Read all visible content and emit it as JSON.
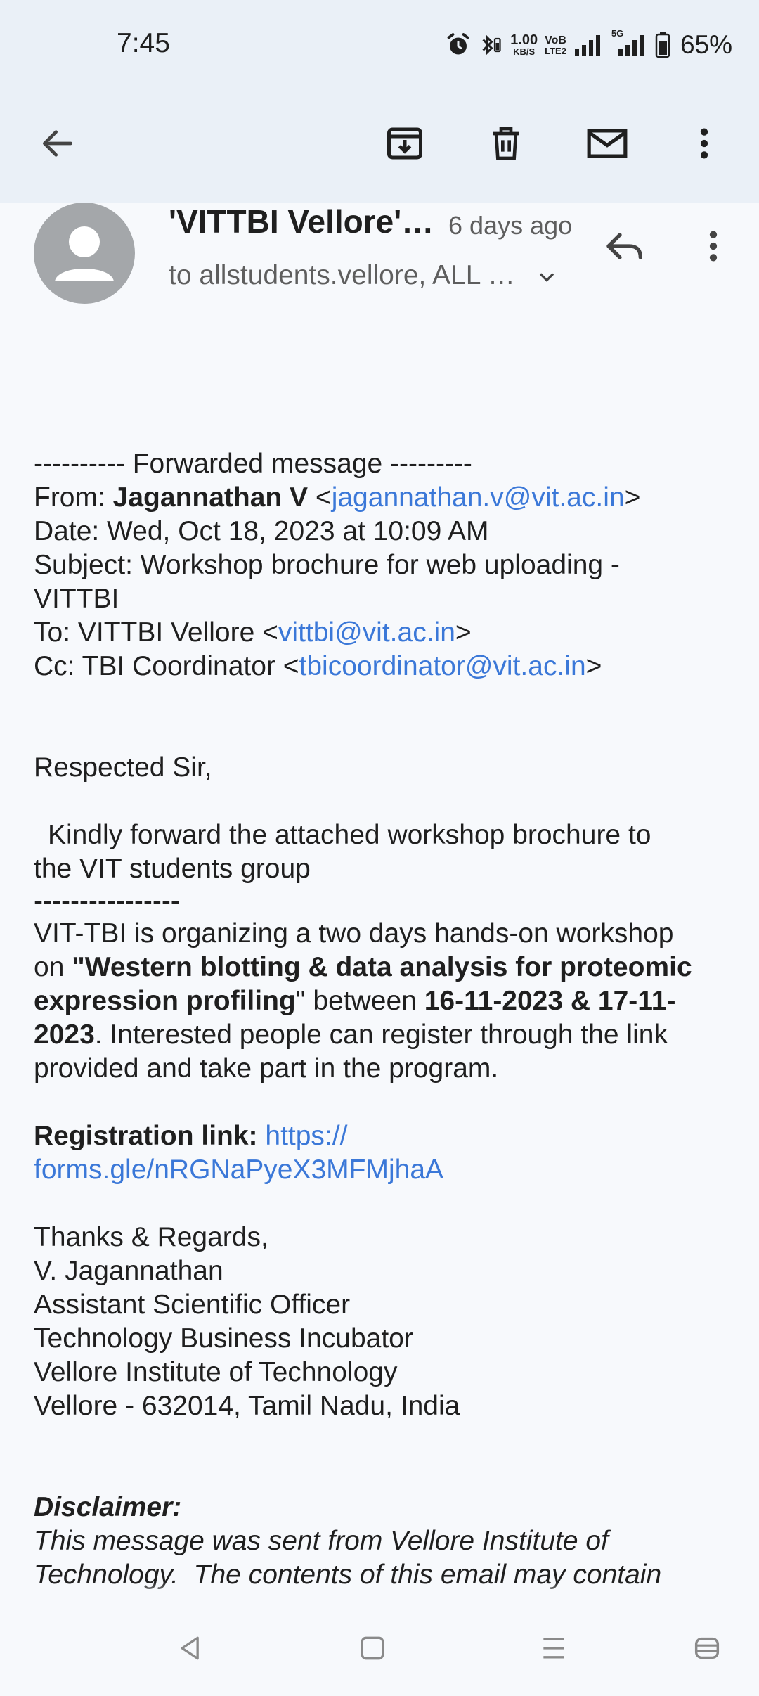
{
  "status_bar": {
    "time": "7:45",
    "speed_value": "1.00",
    "speed_unit": "KB/S",
    "volte_top": "VoB",
    "volte_bottom": "LTE2",
    "network_5g": "5G",
    "battery": "65%"
  },
  "app_bar": {
    "back_icon": "arrow-left-icon",
    "archive_icon": "archive-icon",
    "delete_icon": "trash-icon",
    "mark_unread_icon": "mail-icon",
    "more_icon": "more-vertical-icon"
  },
  "header": {
    "sender": "'VITTBI Vellore' via allstudents.vellore",
    "time_ago": "6 days ago",
    "recipients": "to allstudents.vellore, ALL STUDENTS"
  },
  "body": {
    "forwarded_line": "---------- Forwarded message ---------",
    "from_label": "From: ",
    "from_name": "Jagannathan V",
    "from_email": "jagannathan.v@vit.ac.in",
    "date_line": "Date: Wed, Oct 18, 2023 at 10:09 AM",
    "subject_line_1": "Subject: Workshop brochure for web uploading -",
    "subject_line_2": "VITTBI",
    "to_label": "To: VITTBI Vellore <",
    "to_email": "vittbi@vit.ac.in",
    "cc_label": "Cc: TBI Coordinator <",
    "cc_email": "tbicoordinator@vit.ac.in",
    "greeting": "Respected Sir,",
    "request_1": "Kindly forward the attached workshop brochure to",
    "request_2": "the VIT students group",
    "separator": "----------------",
    "intro_1": "VIT-TBI is organizing a two days hands-on workshop",
    "intro_on": "on ",
    "workshop_title_1": "\"Western blotting & data analysis for proteomic",
    "workshop_title_2": "expression profiling",
    "quote_close": "\"",
    "between": " between ",
    "dates_1": "16-11-2023 & 17-11-",
    "dates_2": "2023",
    "after_dates": ". Interested people can register through the link",
    "closing_line": "provided and take part in the program.",
    "reg_label": "Registration link: ",
    "reg_link_1": "https://",
    "reg_link_2": "forms.gle/nRGNaPyeX3MFMjhaA",
    "sign_1": "Thanks & Regards,",
    "sign_2": "V. Jagannathan",
    "sign_3": "Assistant Scientific Officer",
    "sign_4": "Technology Business Incubator",
    "sign_5": "Vellore Institute of Technology",
    "sign_6": "Vellore - 632014, Tamil Nadu, India",
    "disclaimer_title": "Disclaimer:",
    "disclaimer_1": "This message was sent from Vellore Institute of",
    "disclaimer_2": "Technology.  The contents of this email may contain"
  },
  "nav_bar": {
    "back": "nav-back-icon",
    "home": "nav-home-icon",
    "recents": "nav-recents-icon",
    "assist": "nav-assist-icon"
  }
}
